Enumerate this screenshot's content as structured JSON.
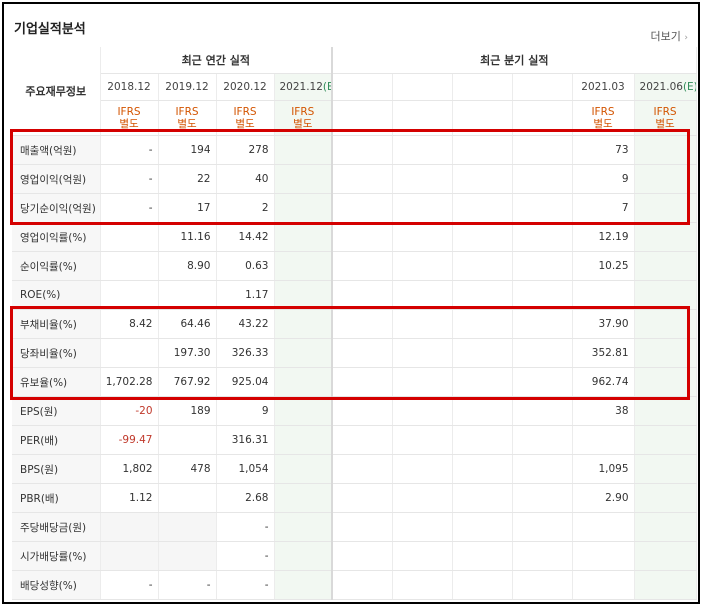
{
  "header": {
    "title": "기업실적분석",
    "more_label": "더보기",
    "more_icon": "chevron-right-icon"
  },
  "table": {
    "corner_label": "주요재무정보",
    "group_annual": "최근 연간 실적",
    "group_quarter": "최근 분기 실적",
    "years": [
      "2018.12",
      "2019.12",
      "2020.12",
      "2021.12"
    ],
    "quarters": [
      "",
      "",
      "",
      "",
      "2021.03",
      "2021.06"
    ],
    "estimate_mark": "(E)",
    "ifrs_top": "IFRS",
    "ifrs_bottom": "별도",
    "rows": [
      {
        "label": "매출액(억원)",
        "a": [
          "-",
          "194",
          "278",
          ""
        ],
        "q": [
          "",
          "",
          "",
          "",
          "73",
          ""
        ]
      },
      {
        "label": "영업이익(억원)",
        "a": [
          "-",
          "22",
          "40",
          ""
        ],
        "q": [
          "",
          "",
          "",
          "",
          "9",
          ""
        ]
      },
      {
        "label": "당기순이익(억원)",
        "a": [
          "-",
          "17",
          "2",
          ""
        ],
        "q": [
          "",
          "",
          "",
          "",
          "7",
          ""
        ]
      },
      {
        "label": "영업이익률(%)",
        "a": [
          "",
          "11.16",
          "14.42",
          ""
        ],
        "q": [
          "",
          "",
          "",
          "",
          "12.19",
          ""
        ]
      },
      {
        "label": "순이익률(%)",
        "a": [
          "",
          "8.90",
          "0.63",
          ""
        ],
        "q": [
          "",
          "",
          "",
          "",
          "10.25",
          ""
        ]
      },
      {
        "label": "ROE(%)",
        "a": [
          "",
          "",
          "1.17",
          ""
        ],
        "q": [
          "",
          "",
          "",
          "",
          "",
          ""
        ]
      },
      {
        "label": "부채비율(%)",
        "a": [
          "8.42",
          "64.46",
          "43.22",
          ""
        ],
        "q": [
          "",
          "",
          "",
          "",
          "37.90",
          ""
        ]
      },
      {
        "label": "당좌비율(%)",
        "a": [
          "",
          "197.30",
          "326.33",
          ""
        ],
        "q": [
          "",
          "",
          "",
          "",
          "352.81",
          ""
        ]
      },
      {
        "label": "유보율(%)",
        "a": [
          "1,702.28",
          "767.92",
          "925.04",
          ""
        ],
        "q": [
          "",
          "",
          "",
          "",
          "962.74",
          ""
        ]
      },
      {
        "label": "EPS(원)",
        "a": [
          "-20",
          "189",
          "9",
          ""
        ],
        "q": [
          "",
          "",
          "",
          "",
          "38",
          ""
        ]
      },
      {
        "label": "PER(배)",
        "a": [
          "-99.47",
          "",
          "316.31",
          ""
        ],
        "q": [
          "",
          "",
          "",
          "",
          "",
          ""
        ]
      },
      {
        "label": "BPS(원)",
        "a": [
          "1,802",
          "478",
          "1,054",
          ""
        ],
        "q": [
          "",
          "",
          "",
          "",
          "1,095",
          ""
        ]
      },
      {
        "label": "PBR(배)",
        "a": [
          "1.12",
          "",
          "2.68",
          ""
        ],
        "q": [
          "",
          "",
          "",
          "",
          "2.90",
          ""
        ]
      },
      {
        "label": "주당배당금(원)",
        "a": [
          "",
          "",
          "-",
          ""
        ],
        "q": [
          "",
          "",
          "",
          "",
          "",
          ""
        ]
      },
      {
        "label": "시가배당률(%)",
        "a": [
          "",
          "",
          "-",
          ""
        ],
        "q": [
          "",
          "",
          "",
          "",
          "",
          ""
        ]
      },
      {
        "label": "배당성향(%)",
        "a": [
          "-",
          "-",
          "-",
          ""
        ],
        "q": [
          "",
          "",
          "",
          "",
          "",
          ""
        ]
      }
    ]
  },
  "colors": {
    "highlight": "#d40000",
    "ifrs": "#d35400",
    "negative": "#c0392b",
    "estimate": "#2e8b57"
  }
}
